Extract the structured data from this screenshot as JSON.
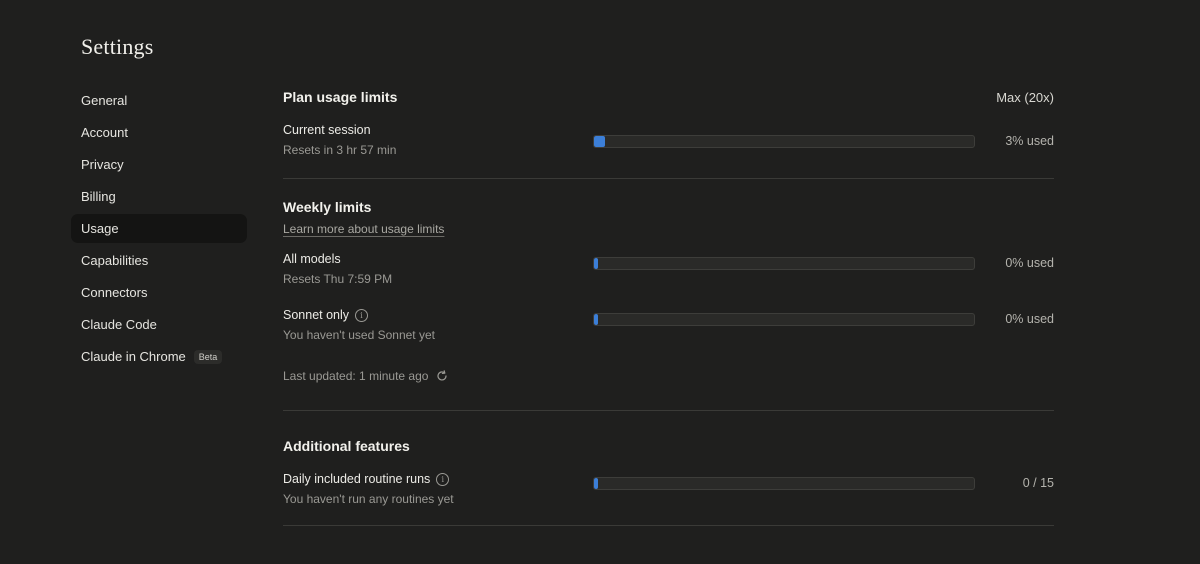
{
  "page": {
    "title": "Settings"
  },
  "sidebar": {
    "items": [
      {
        "label": "General"
      },
      {
        "label": "Account"
      },
      {
        "label": "Privacy"
      },
      {
        "label": "Billing"
      },
      {
        "label": "Usage",
        "active": true
      },
      {
        "label": "Capabilities"
      },
      {
        "label": "Connectors"
      },
      {
        "label": "Claude Code"
      },
      {
        "label": "Claude in Chrome",
        "badge": "Beta"
      }
    ]
  },
  "plan": {
    "title": "Plan usage limits",
    "plan_name": "Max (20x)",
    "current_session": {
      "label": "Current session",
      "sub": "Resets in 3 hr 57 min",
      "value_text": "3% used",
      "fraction": 0.03
    }
  },
  "weekly": {
    "title": "Weekly limits",
    "link": "Learn more about usage limits",
    "all_models": {
      "label": "All models",
      "sub": "Resets Thu 7:59 PM",
      "value_text": "0% used",
      "fraction": 0.0
    },
    "sonnet_only": {
      "label": "Sonnet only",
      "sub": "You haven't used Sonnet yet",
      "value_text": "0% used",
      "fraction": 0.0
    },
    "last_updated": "Last updated: 1 minute ago"
  },
  "additional": {
    "title": "Additional features",
    "routine_runs": {
      "label": "Daily included routine runs",
      "sub": "You haven't run any routines yet",
      "value_text": "0 / 15",
      "fraction": 0.0
    }
  },
  "colors": {
    "accent": "#3c7fd8",
    "background": "#1f1f1e"
  },
  "icons": {
    "info": "info-icon",
    "refresh": "refresh-icon"
  }
}
